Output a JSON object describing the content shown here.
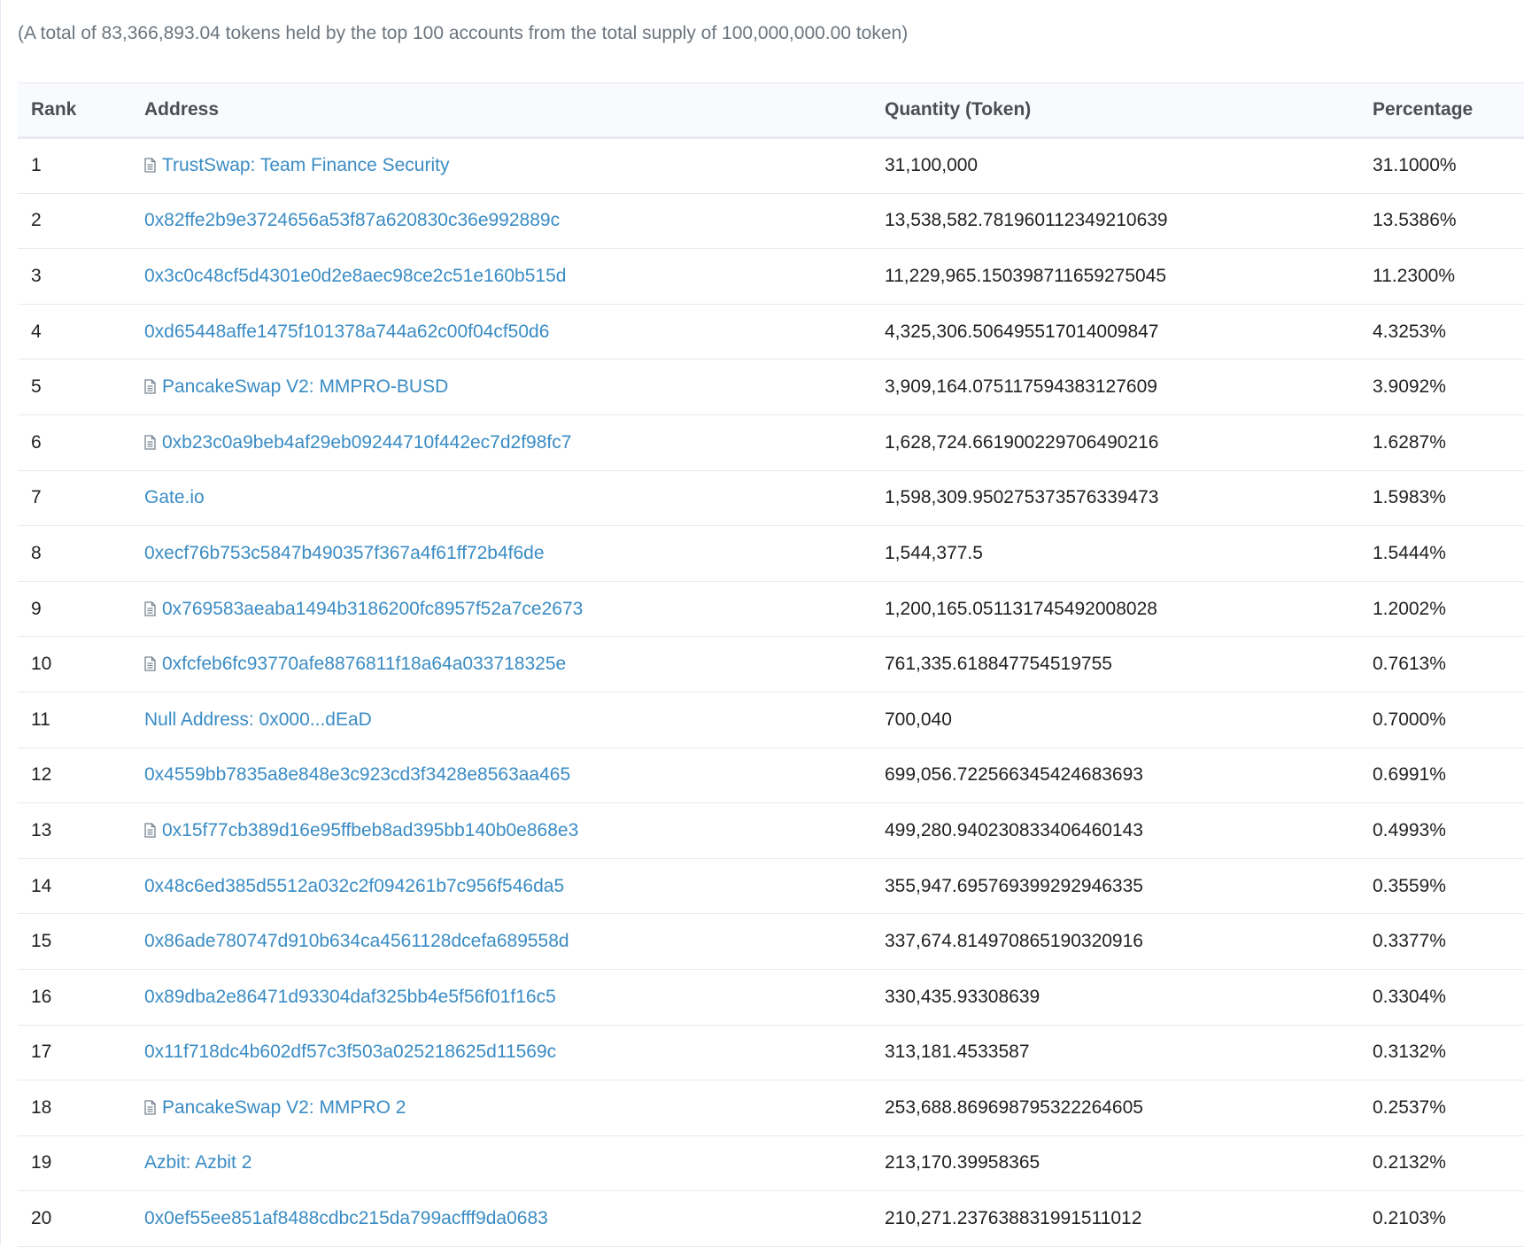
{
  "summary": "(A total of 83,366,893.04 tokens held by the top 100 accounts from the total supply of 100,000,000.00 token)",
  "colors": {
    "link": "#3a8cc4",
    "header_bg": "#f8fafd",
    "border": "#e7eaf3"
  },
  "table": {
    "headers": {
      "rank": "Rank",
      "address": "Address",
      "quantity": "Quantity (Token)",
      "percentage": "Percentage"
    },
    "rows": [
      {
        "rank": "1",
        "address": "TrustSwap: Team Finance Security",
        "contract_icon": "document-icon",
        "quantity": "31,100,000",
        "percentage": "31.1000%"
      },
      {
        "rank": "2",
        "address": "0x82ffe2b9e3724656a53f87a620830c36e992889c",
        "contract_icon": "",
        "quantity": "13,538,582.781960112349210639",
        "percentage": "13.5386%"
      },
      {
        "rank": "3",
        "address": "0x3c0c48cf5d4301e0d2e8aec98ce2c51e160b515d",
        "contract_icon": "",
        "quantity": "11,229,965.150398711659275045",
        "percentage": "11.2300%"
      },
      {
        "rank": "4",
        "address": "0xd65448affe1475f101378a744a62c00f04cf50d6",
        "contract_icon": "",
        "quantity": "4,325,306.506495517014009847",
        "percentage": "4.3253%"
      },
      {
        "rank": "5",
        "address": "PancakeSwap V2: MMPRO-BUSD",
        "contract_icon": "document-icon",
        "quantity": "3,909,164.075117594383127609",
        "percentage": "3.9092%"
      },
      {
        "rank": "6",
        "address": "0xb23c0a9beb4af29eb09244710f442ec7d2f98fc7",
        "contract_icon": "document-icon",
        "quantity": "1,628,724.661900229706490216",
        "percentage": "1.6287%"
      },
      {
        "rank": "7",
        "address": "Gate.io",
        "contract_icon": "",
        "quantity": "1,598,309.950275373576339473",
        "percentage": "1.5983%"
      },
      {
        "rank": "8",
        "address": "0xecf76b753c5847b490357f367a4f61ff72b4f6de",
        "contract_icon": "",
        "quantity": "1,544,377.5",
        "percentage": "1.5444%"
      },
      {
        "rank": "9",
        "address": "0x769583aeaba1494b3186200fc8957f52a7ce2673",
        "contract_icon": "document-icon",
        "quantity": "1,200,165.051131745492008028",
        "percentage": "1.2002%"
      },
      {
        "rank": "10",
        "address": "0xfcfeb6fc93770afe8876811f18a64a033718325e",
        "contract_icon": "document-icon",
        "quantity": "761,335.618847754519755",
        "percentage": "0.7613%"
      },
      {
        "rank": "11",
        "address": "Null Address: 0x000...dEaD",
        "contract_icon": "",
        "quantity": "700,040",
        "percentage": "0.7000%"
      },
      {
        "rank": "12",
        "address": "0x4559bb7835a8e848e3c923cd3f3428e8563aa465",
        "contract_icon": "",
        "quantity": "699,056.722566345424683693",
        "percentage": "0.6991%"
      },
      {
        "rank": "13",
        "address": "0x15f77cb389d16e95ffbeb8ad395bb140b0e868e3",
        "contract_icon": "document-icon",
        "quantity": "499,280.940230833406460143",
        "percentage": "0.4993%"
      },
      {
        "rank": "14",
        "address": "0x48c6ed385d5512a032c2f094261b7c956f546da5",
        "contract_icon": "",
        "quantity": "355,947.695769399292946335",
        "percentage": "0.3559%"
      },
      {
        "rank": "15",
        "address": "0x86ade780747d910b634ca4561128dcefa689558d",
        "contract_icon": "",
        "quantity": "337,674.814970865190320916",
        "percentage": "0.3377%"
      },
      {
        "rank": "16",
        "address": "0x89dba2e86471d93304daf325bb4e5f56f01f16c5",
        "contract_icon": "",
        "quantity": "330,435.93308639",
        "percentage": "0.3304%"
      },
      {
        "rank": "17",
        "address": "0x11f718dc4b602df57c3f503a025218625d11569c",
        "contract_icon": "",
        "quantity": "313,181.4533587",
        "percentage": "0.3132%"
      },
      {
        "rank": "18",
        "address": "PancakeSwap V2: MMPRO 2",
        "contract_icon": "document-icon",
        "quantity": "253,688.869698795322264605",
        "percentage": "0.2537%"
      },
      {
        "rank": "19",
        "address": "Azbit: Azbit 2",
        "contract_icon": "",
        "quantity": "213,170.39958365",
        "percentage": "0.2132%"
      },
      {
        "rank": "20",
        "address": "0x0ef55ee851af8488cdbc215da799acfff9da0683",
        "contract_icon": "",
        "quantity": "210,271.237638831991511012",
        "percentage": "0.2103%"
      }
    ]
  }
}
